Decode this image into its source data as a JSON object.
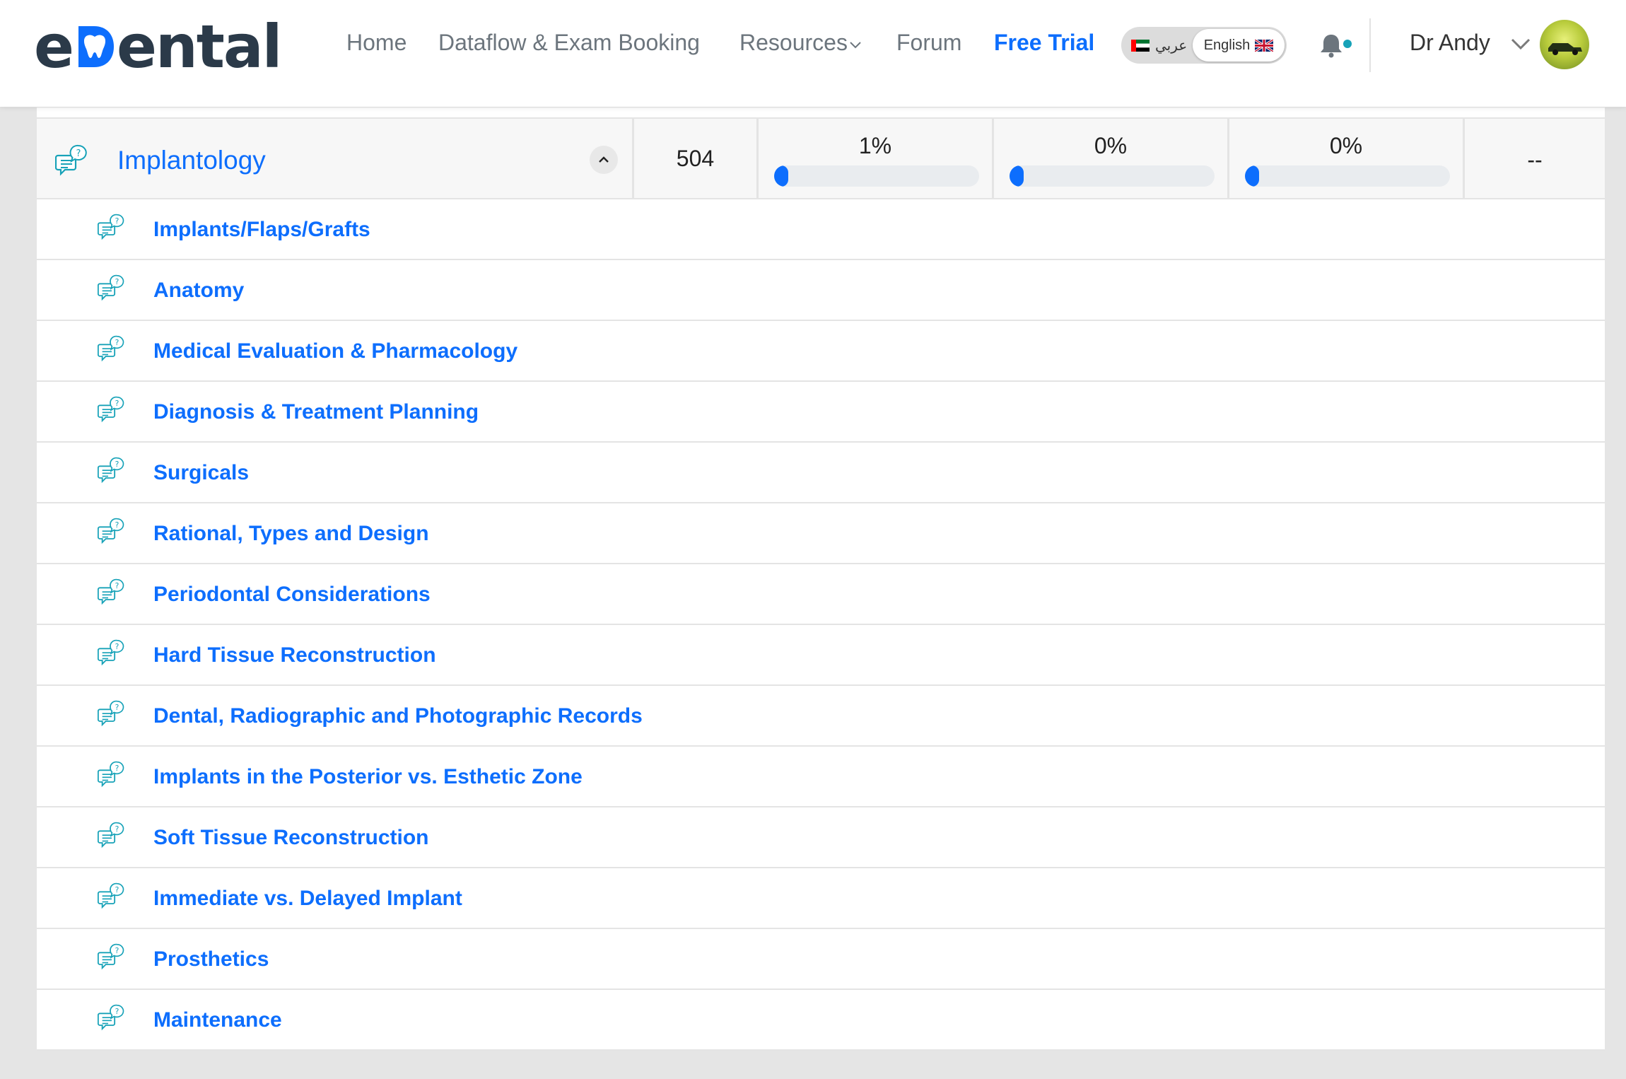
{
  "header": {
    "logo_text_start": "e",
    "logo_text_end": "ental",
    "nav": [
      {
        "label": "Home"
      },
      {
        "label": "Dataflow & Exam Booking"
      },
      {
        "label": "Resources"
      },
      {
        "label": "Forum"
      },
      {
        "label": "Free Trial"
      }
    ],
    "lang": {
      "arabic_label": "عربي",
      "english_label": "English",
      "selected": "English"
    },
    "user": {
      "name": "Dr Andy"
    },
    "icons": {
      "bell": "bell-icon",
      "chevron": "chevron-down-icon",
      "avatar": "avatar-image"
    },
    "colors": {
      "accent": "#0d6efd",
      "logo": "#2b3a49",
      "notification_dot": "#17a2b8"
    }
  },
  "category": {
    "title": "Implantology",
    "count": "504",
    "progress": [
      {
        "label": "1%",
        "value": 1
      },
      {
        "label": "0%",
        "value": 0
      },
      {
        "label": "0%",
        "value": 0
      }
    ],
    "last": "--",
    "expanded": true
  },
  "subtopics": [
    {
      "label": "Implants/Flaps/Grafts"
    },
    {
      "label": "Anatomy"
    },
    {
      "label": "Medical Evaluation & Pharmacology"
    },
    {
      "label": "Diagnosis & Treatment Planning"
    },
    {
      "label": "Surgicals"
    },
    {
      "label": "Rational, Types and Design"
    },
    {
      "label": "Periodontal Considerations"
    },
    {
      "label": "Hard Tissue Reconstruction"
    },
    {
      "label": "Dental, Radiographic and Photographic Records"
    },
    {
      "label": "Implants in the Posterior vs. Esthetic Zone"
    },
    {
      "label": "Soft Tissue Reconstruction"
    },
    {
      "label": "Immediate vs. Delayed Implant"
    },
    {
      "label": "Prosthetics"
    },
    {
      "label": "Maintenance"
    }
  ]
}
